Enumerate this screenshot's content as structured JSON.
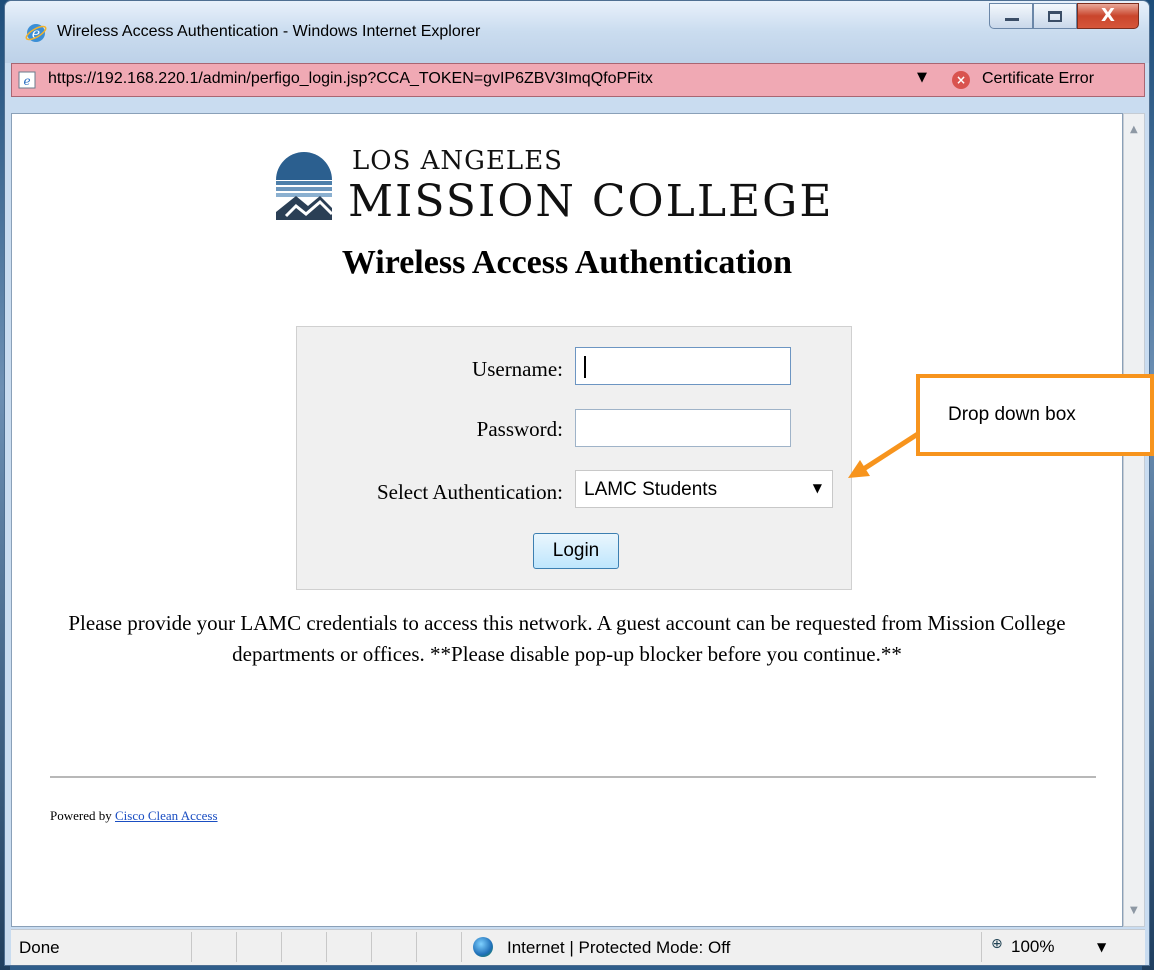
{
  "window": {
    "title": "Wireless Access Authentication - Windows Internet Explorer",
    "close_glyph": "X"
  },
  "address_bar": {
    "url": "https://192.168.220.1/admin/perfigo_login.jsp?CCA_TOKEN=gvIP6ZBV3ImqQfoPFitx",
    "dropdown_glyph": "▼",
    "certificate_status": "Certificate Error"
  },
  "page": {
    "logo_line1": "LOS ANGELES",
    "logo_line2": "MISSION COLLEGE",
    "title": "Wireless Access Authentication"
  },
  "form": {
    "username_label": "Username:",
    "username_value": "",
    "password_label": "Password:",
    "password_value": "",
    "auth_label": "Select Authentication:",
    "auth_selected": "LAMC Students",
    "auth_arrow": "▼",
    "login_label": "Login"
  },
  "info_text": "Please provide your LAMC credentials to access this network. A guest account can be requested from Mission College departments or offices. **Please disable pop-up blocker before you continue.**",
  "footer": {
    "powered_prefix": "Powered by ",
    "powered_link": "Cisco Clean Access"
  },
  "status_bar": {
    "status": "Done",
    "zone": "Internet | Protected Mode: Off",
    "zoom": "100%",
    "zoom_arrow": "▼"
  },
  "annotation": {
    "callout_text": "Drop down box",
    "color": "#f7941d"
  },
  "colors": {
    "address_bar_error": "#f0a9b4",
    "link": "#1a4ec2"
  }
}
